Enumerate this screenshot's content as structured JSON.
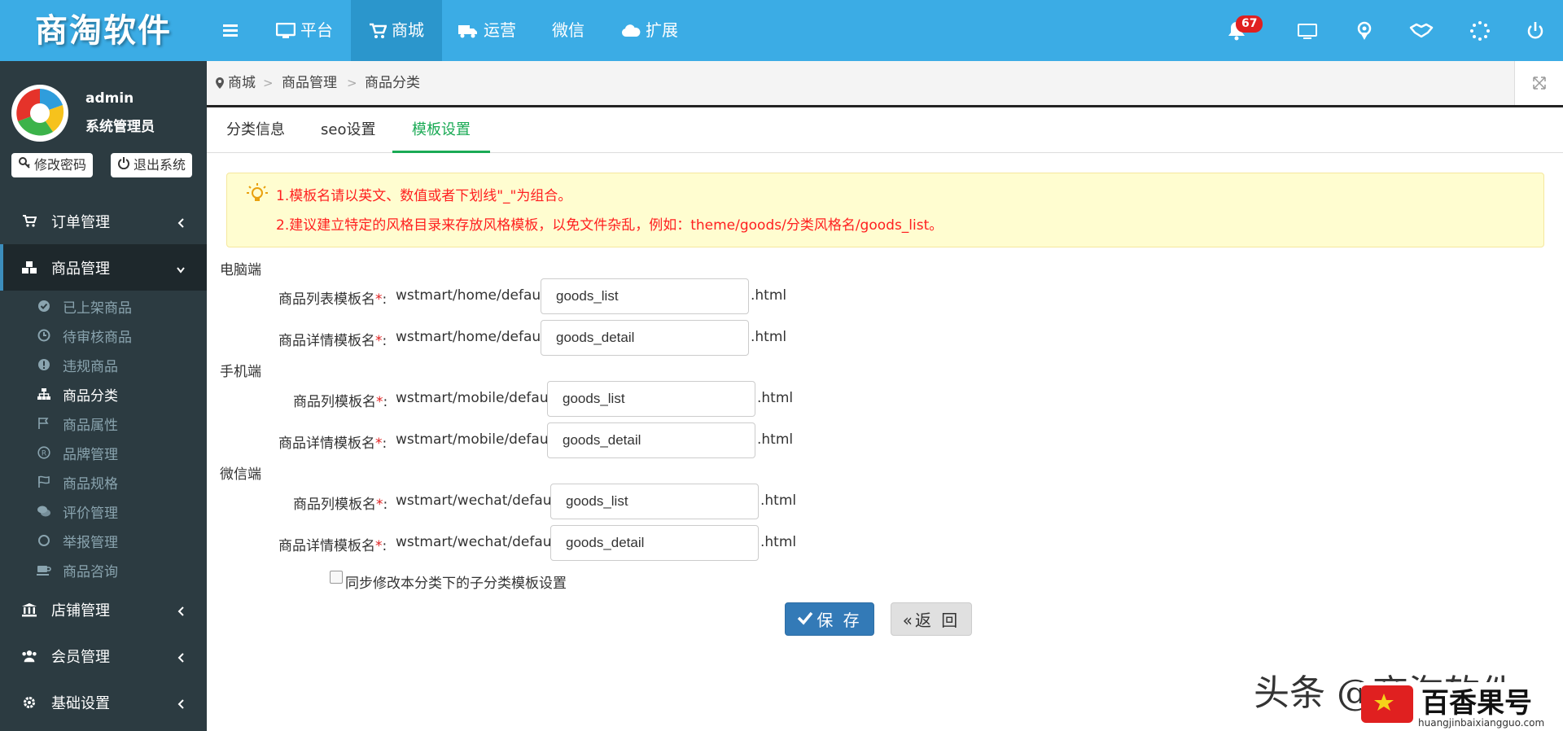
{
  "app": {
    "logo_text": "商淘软件"
  },
  "topnav": [
    {
      "label": "平台",
      "icon": "desktop-icon"
    },
    {
      "label": "商城",
      "icon": "cart-icon"
    },
    {
      "label": "运营",
      "icon": "truck-icon"
    },
    {
      "label": "微信",
      "icon": ""
    },
    {
      "label": "扩展",
      "icon": "cloud-icon"
    }
  ],
  "notifications": {
    "count": "67"
  },
  "user": {
    "name": "admin",
    "role": "系统管理员",
    "change_password": "修改密码",
    "logout": "退出系统"
  },
  "sidebar": {
    "menus": [
      {
        "label": "订单管理",
        "icon": "cart-icon"
      },
      {
        "label": "商品管理",
        "icon": "cubes-icon"
      },
      {
        "label": "店铺管理",
        "icon": "bank-icon"
      },
      {
        "label": "会员管理",
        "icon": "users-icon"
      },
      {
        "label": "基础设置",
        "icon": "gear-icon"
      }
    ],
    "submenu": [
      {
        "label": "已上架商品",
        "icon": "check-circle-icon"
      },
      {
        "label": "待审核商品",
        "icon": "clock-icon"
      },
      {
        "label": "违规商品",
        "icon": "exclamation-icon"
      },
      {
        "label": "商品分类",
        "icon": "sitemap-icon"
      },
      {
        "label": "商品属性",
        "icon": "flag-icon"
      },
      {
        "label": "品牌管理",
        "icon": "registered-icon"
      },
      {
        "label": "商品规格",
        "icon": "flag-checkered-icon"
      },
      {
        "label": "评价管理",
        "icon": "comments-icon"
      },
      {
        "label": "举报管理",
        "icon": "circle-icon"
      },
      {
        "label": "商品咨询",
        "icon": "coffee-icon"
      }
    ]
  },
  "breadcrumb": {
    "items": [
      "商城",
      "商品管理",
      "商品分类"
    ],
    "separator": ">"
  },
  "tabs": [
    "分类信息",
    "seo设置",
    "模板设置"
  ],
  "tip": {
    "line1": "1.模板名请以英文、数值或者下划线\"_\"为组合。",
    "line2": "2.建议建立特定的风格目录来存放风格模板，以免文件杂乱，例如：theme/goods/分类风格名/goods_list。"
  },
  "form": {
    "required_mark": "*",
    "colon": ":",
    "suffix": ".html",
    "pc": {
      "section": "电脑端",
      "list_label": "商品列表模板名",
      "detail_label": "商品详情模板名",
      "prefix": "wstmart/home/default/",
      "list_value": "goods_list",
      "detail_value": "goods_detail"
    },
    "mobile": {
      "section": "手机端",
      "list_label": "商品列模板名",
      "detail_label": "商品详情模板名",
      "prefix": "wstmart/mobile/default/",
      "list_value": "goods_list",
      "detail_value": "goods_detail"
    },
    "wechat": {
      "section": "微信端",
      "list_label": "商品列模板名",
      "detail_label": "商品详情模板名",
      "prefix": "wstmart/wechat/default/",
      "list_value": "goods_list",
      "detail_value": "goods_detail"
    },
    "sync_label": "同步修改本分类下的子分类模板设置",
    "save_label": "保 存",
    "back_label": "«返 回"
  },
  "watermark": {
    "left": "头条 @商淘软件",
    "title": "百香果号",
    "url": "huangjinbaixiangguo.com"
  },
  "colors": {
    "topbar": "#3bace5",
    "sidebar": "#2c3b41",
    "tip_text": "#ff1f1f",
    "active_tab": "#1aaa55",
    "save_button": "#337ab7"
  }
}
